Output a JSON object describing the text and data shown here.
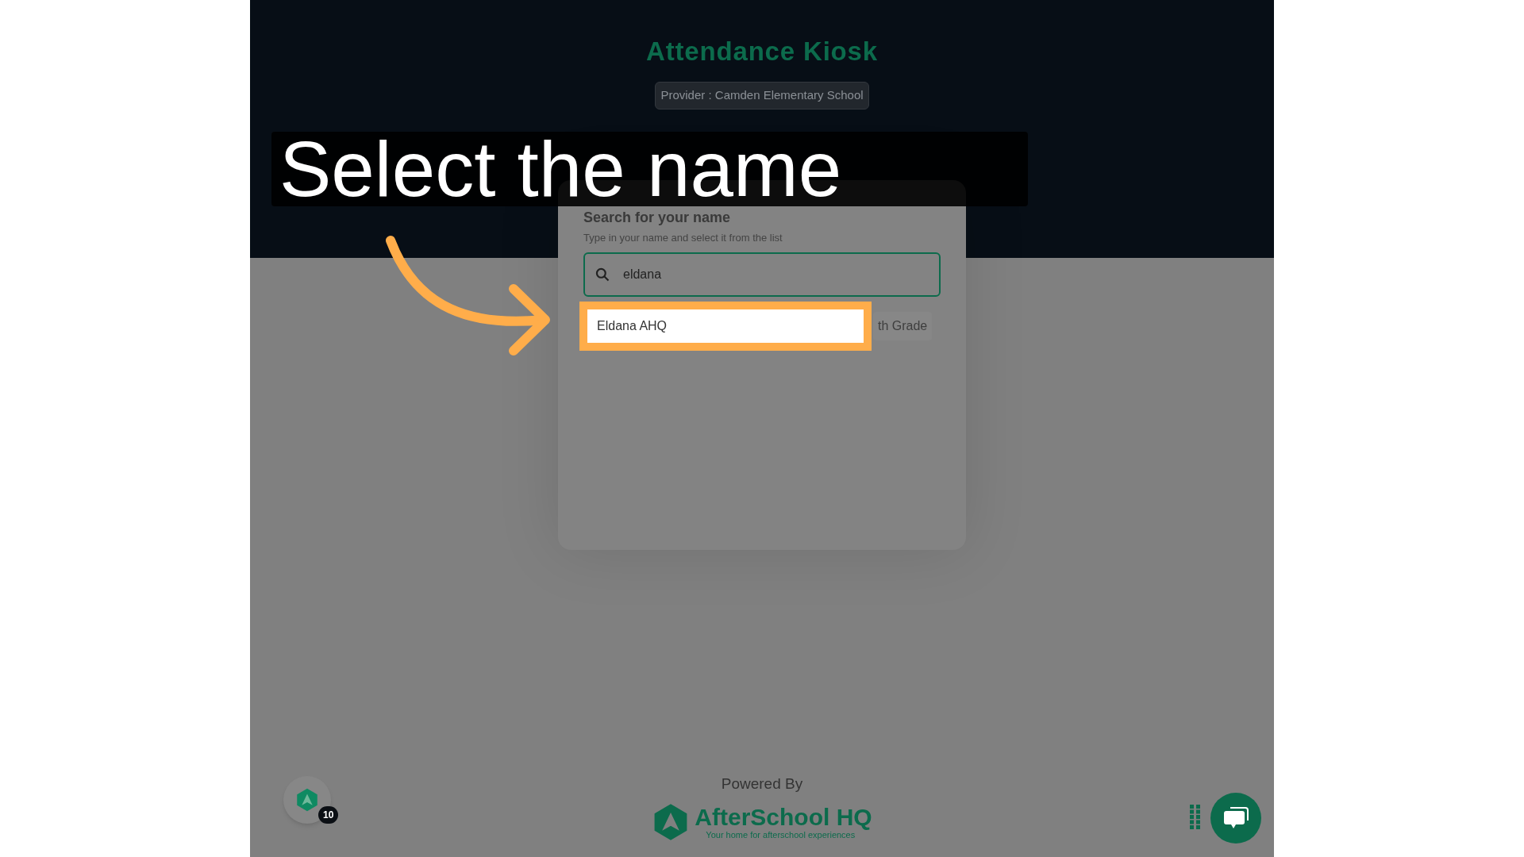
{
  "header": {
    "title": "Attendance Kiosk",
    "provider": "Provider : Camden Elementary School"
  },
  "caption": "Select the name",
  "search_card": {
    "title": "Search for your name",
    "subtitle": "Type in your name and select it from the list",
    "search": {
      "value": "eldana"
    },
    "results": [
      {
        "name": "Eldana AHQ",
        "grade": "th Grade",
        "highlighted": true
      }
    ]
  },
  "footer": {
    "powered_by": "Powered By",
    "brand": "AfterSchool HQ",
    "tagline": "Your home for afterschool experiences"
  },
  "notification_badge": "10"
}
